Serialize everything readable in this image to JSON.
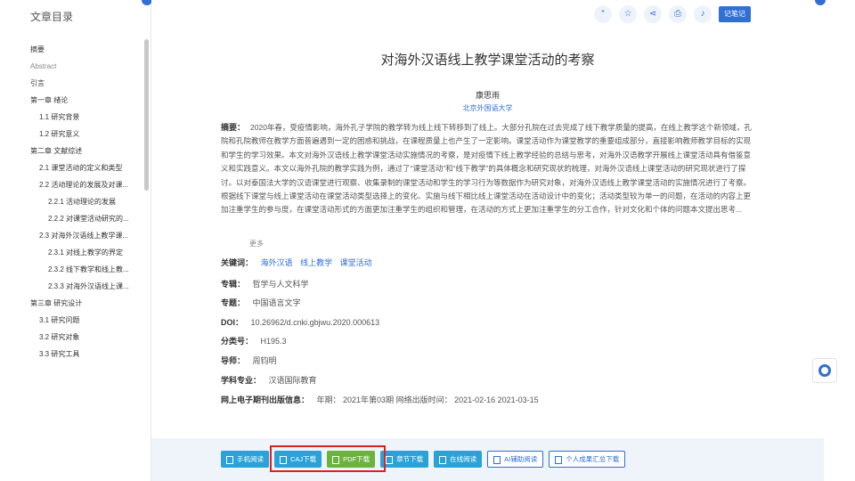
{
  "toc": {
    "title": "文章目录",
    "items": [
      {
        "label": "摘要",
        "level": 1
      },
      {
        "label": "Abstract",
        "level": 1,
        "muted": true
      },
      {
        "label": "引言",
        "level": 1
      },
      {
        "label": "第一章 绪论",
        "level": 1
      },
      {
        "label": "1.1 研究背景",
        "level": 2
      },
      {
        "label": "1.2 研究意义",
        "level": 2
      },
      {
        "label": "第二章 文献综述",
        "level": 1
      },
      {
        "label": "2.1 课堂活动的定义和类型",
        "level": 2
      },
      {
        "label": "2.2 活动理论的发展及对课...",
        "level": 2
      },
      {
        "label": "2.2.1 活动理论的发展",
        "level": 3
      },
      {
        "label": "2.2.2 对课堂活动研究的...",
        "level": 3
      },
      {
        "label": "2.3 对海外汉语线上教学课...",
        "level": 2
      },
      {
        "label": "2.3.1 对线上教学的界定",
        "level": 3
      },
      {
        "label": "2.3.2 线下教学和线上教...",
        "level": 3
      },
      {
        "label": "2.3.3 对海外汉语线上课...",
        "level": 3
      },
      {
        "label": "第三章 研究设计",
        "level": 1
      },
      {
        "label": "3.1 研究问题",
        "level": 2
      },
      {
        "label": "3.2 研究对象",
        "level": 2
      },
      {
        "label": "3.3 研究工具",
        "level": 2
      }
    ]
  },
  "toolbar": {
    "icons": [
      "quote-icon",
      "star-icon",
      "share-icon",
      "print-icon",
      "bell-icon"
    ],
    "icon_glyphs": [
      "“",
      "☆",
      "⋖",
      "⎙",
      "♪"
    ],
    "note_label": "记笔记"
  },
  "article": {
    "title": "对海外汉语线上教学课堂活动的考察",
    "author": "康思雨",
    "affiliation": "北京外国语大学",
    "abstract_label": "摘要：",
    "abstract_text": "2020年春，受疫情影响，海外孔子学院的教学转为线上线下转移到了线上。大部分孔院在过去完成了线下教学质量的提高，在线上教学这个新领域，孔院和孔院教师在教学方面普遍遇到一定的困惑和挑战，在课程质量上也产生了一定影响。课堂活动作为课堂教学的重要组成部分，直接影响教师教学目标的实现和学生的学习效果。本文对海外汉语线上教学课堂活动实施情况的考察，是对疫情下线上教学经验的总结与思考，对海外汉语教学开展线上课堂活动具有借鉴意义和实践意义。本文以海外孔院的教学实践为例，通过了“课堂活动”和“线下教学”的具体概念和研究现状的梳理，对海外汉语线上课堂活动的研究现状进行了探讨。以对泰国法大学的汉语课堂进行观察、收集录制的课堂活动和学生的学习行为等数据作为研究对象，对海外汉语线上教学课堂活动的实施情况进行了考察。根据线下课堂与线上课堂活动在课堂活动类型选择上的变化、实施与线下相比线上课堂活动在活动设计中的变化；活动类型较为单一的问题，在活动的内容上更加注重学生的参与度，在课堂活动形式的方面更加注重学生的组织和管理，在活动的方式上更加注重学生的分工合作，针对文化和个体的问题本文提出思考...",
    "abstract_more": "更多",
    "fields": [
      {
        "label": "关键词：",
        "keywords": [
          "海外汉语",
          "线上教学",
          "课堂活动"
        ]
      },
      {
        "label": "专辑：",
        "value": "哲学与人文科学"
      },
      {
        "label": "专题：",
        "value": "中国语言文字"
      },
      {
        "label": "DOI：",
        "value": "10.26962/d.cnki.gbjwu.2020.000613"
      },
      {
        "label": "分类号：",
        "value": "H195.3"
      },
      {
        "label": "导师：",
        "value": "周钧明"
      },
      {
        "label": "学科专业：",
        "value": "汉语国际教育"
      },
      {
        "label": "网络出版信息：",
        "value": "年期： 2021年第03期    网络出版时间： 2021-02-16    2021-03-15",
        "label_full": "网上电子期刊出版信息："
      }
    ]
  },
  "downloads": {
    "buttons": [
      {
        "label": "手机阅读",
        "style": "blue"
      },
      {
        "label": "CAJ下载",
        "style": "blue"
      },
      {
        "label": "PDF下载",
        "style": "green"
      },
      {
        "label": "章节下载",
        "style": "blue"
      },
      {
        "label": "在线阅读",
        "style": "blue"
      },
      {
        "label": "AI辅助阅读",
        "style": "white"
      },
      {
        "label": "个人成果汇总下载",
        "style": "white"
      }
    ]
  }
}
